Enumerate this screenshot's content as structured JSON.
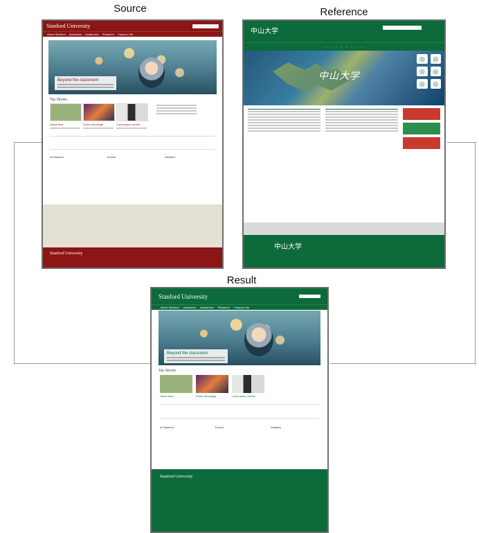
{
  "labels": {
    "source": "Source",
    "reference": "Reference",
    "result": "Result"
  },
  "source": {
    "logo": "Stanford University",
    "nav": [
      "About Stanford",
      "Admission",
      "Academics",
      "Research",
      "Campus Life"
    ],
    "hero_caption": "Beyond the classroom",
    "section_title": "Top Stories",
    "stories": [
      "Game time",
      "Police shootings",
      "Concussion control"
    ],
    "columns": [
      "At Stanford",
      "Events",
      "Athletics"
    ],
    "footer_logo": "Stanford University"
  },
  "reference": {
    "logo": "中山大学",
    "banner_title": "中山大学"
  },
  "result": {
    "logo": "Stanford University",
    "nav": [
      "About Stanford",
      "Admission",
      "Academics",
      "Research",
      "Campus Life"
    ],
    "hero_caption": "Beyond the classroom",
    "section_title": "Top Stories",
    "stories": [
      "Game time",
      "Police shootings",
      "Concussion control"
    ],
    "columns": [
      "At Stanford",
      "Events",
      "Athletics"
    ],
    "footer_logo": "Stanford University"
  }
}
